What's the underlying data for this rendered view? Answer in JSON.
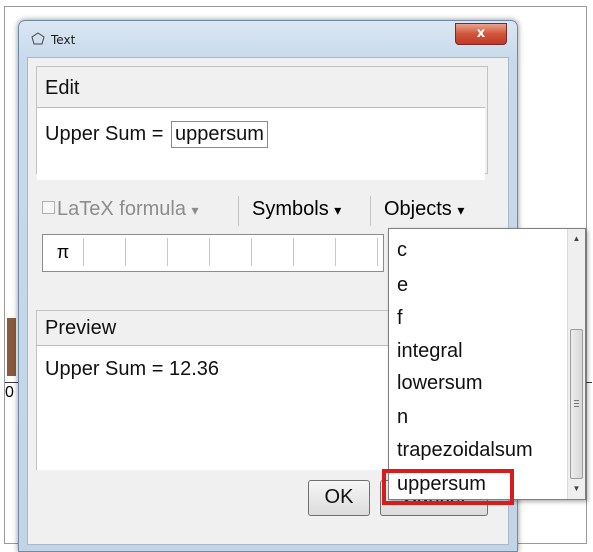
{
  "window": {
    "title": "Text",
    "close_label": "x"
  },
  "edit": {
    "group_label": "Edit",
    "text_prefix": "Upper Sum = ",
    "object_token": "uppersum"
  },
  "toolbar": {
    "latex_label": "LaTeX formula",
    "latex_arrow": "▾",
    "symbols_label": "Symbols",
    "symbols_arrow": "▾",
    "objects_label": "Objects",
    "objects_arrow": "▾"
  },
  "symbols": {
    "first": "π"
  },
  "preview": {
    "group_label": "Preview",
    "text": "Upper Sum = 12.36"
  },
  "buttons": {
    "ok": "OK",
    "cancel": "Cancel"
  },
  "objects_menu": {
    "items": [
      "c",
      "e",
      "f",
      "integral",
      "lowersum",
      "n",
      "trapezoidalsum",
      "uppersum"
    ],
    "highlighted_item": "uppersum",
    "highlight_color": "#d81b1b"
  },
  "background": {
    "partial_label": "0"
  }
}
